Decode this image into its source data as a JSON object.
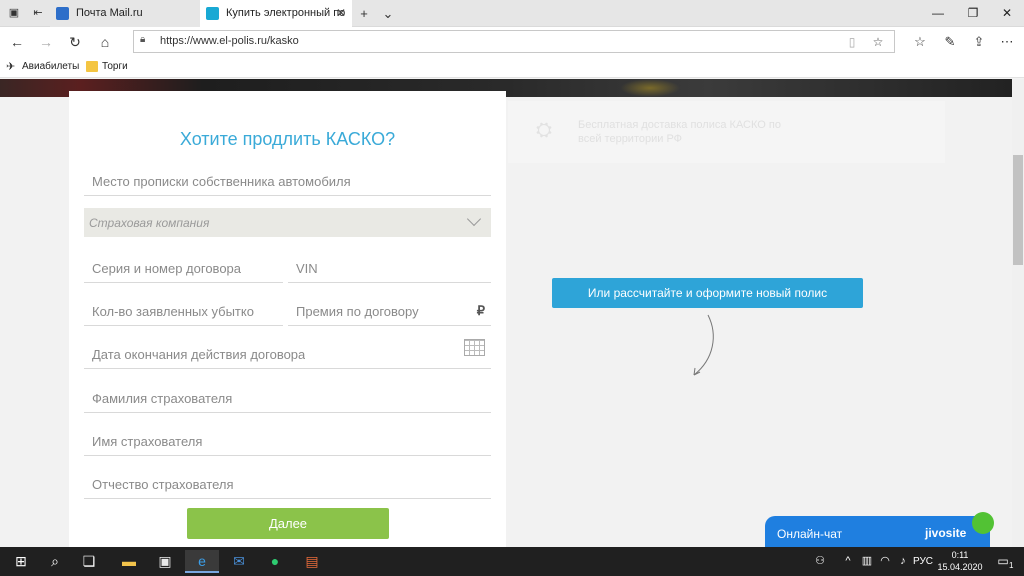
{
  "browser": {
    "tabs": [
      {
        "label": "Почта Mail.ru",
        "active": false,
        "favicon_color": "#2d6ec9"
      },
      {
        "label": "Купить электронный по",
        "active": true,
        "favicon_color": "#19a9d4"
      }
    ],
    "url": "https://www.el-polis.ru/kasko",
    "favorites": [
      {
        "label": "Авиабилеты",
        "icon": "plane-icon"
      },
      {
        "label": "Торги",
        "icon": "folder-icon"
      }
    ]
  },
  "form": {
    "title": "Хотите продлить КАСКО?",
    "fields": {
      "registration": "Место прописки собственника автомобиля",
      "insurer_placeholder": "Страховая компания",
      "contract_number": "Серия и номер договора",
      "vin": "VIN",
      "claims_count": "Кол-во заявленных убытко",
      "premium": "Премия по договору",
      "premium_currency": "₽",
      "expiry_date": "Дата окончания действия договора",
      "last_name": "Фамилия страхователя",
      "first_name": "Имя страхователя",
      "middle_name": "Отчество страхователя"
    },
    "submit_label": "Далее"
  },
  "info": {
    "text": "Бесплатная доставка полиса КАСКО по всей территории РФ"
  },
  "calc_button_label": "Или рассчитайте и оформите новый полис",
  "chat": {
    "label": "Онлайн-чат",
    "brand": "jivosite"
  },
  "taskbar": {
    "language": "РУС",
    "time": "0:11",
    "date": "15.04.2020",
    "notification_count": "1"
  },
  "colors": {
    "accent": "#2ea4d8",
    "title": "#3aaad8",
    "submit": "#8bc34a",
    "chat": "#1f7fe0"
  }
}
